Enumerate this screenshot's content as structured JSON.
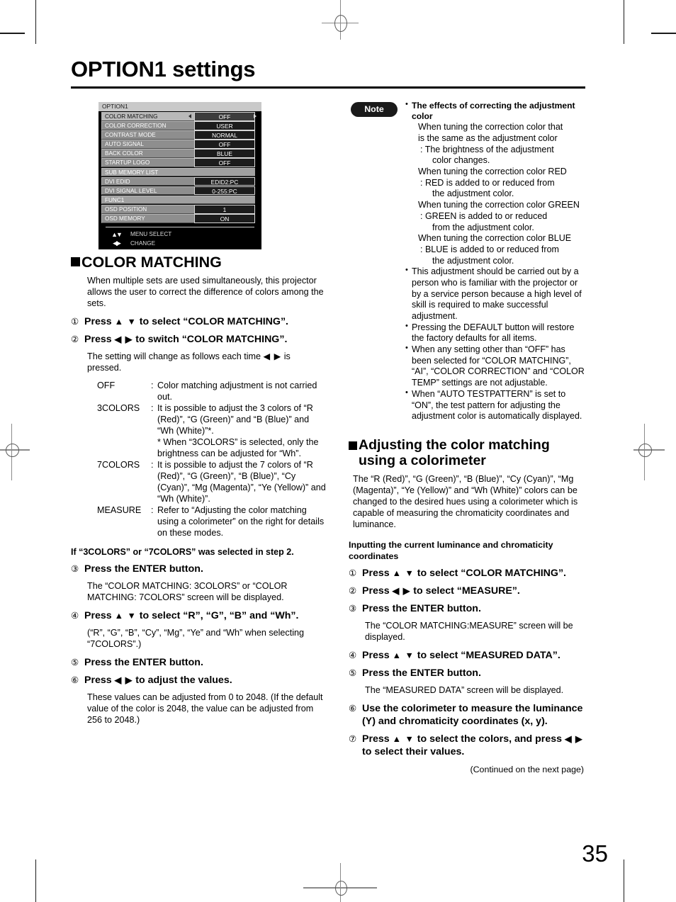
{
  "page": {
    "title": "OPTION1 settings",
    "number": "35"
  },
  "osd": {
    "title": "OPTION1",
    "rows": [
      {
        "label": "COLOR MATCHING",
        "value": "OFF",
        "selected": true,
        "full": false,
        "arrows": true
      },
      {
        "label": "COLOR CORRECTION",
        "value": "USER",
        "selected": false,
        "full": false,
        "arrows": false
      },
      {
        "label": "CONTRAST MODE",
        "value": "NORMAL",
        "selected": false,
        "full": false,
        "arrows": false
      },
      {
        "label": "AUTO SIGNAL",
        "value": "OFF",
        "selected": false,
        "full": false,
        "arrows": false
      },
      {
        "label": "BACK COLOR",
        "value": "BLUE",
        "selected": false,
        "full": false,
        "arrows": false
      },
      {
        "label": "STARTUP LOGO",
        "value": "OFF",
        "selected": false,
        "full": false,
        "arrows": false
      },
      {
        "label": "SUB MEMORY LIST",
        "value": "",
        "selected": false,
        "full": true,
        "arrows": false
      },
      {
        "label": "DVI EDID",
        "value": "EDID2:PC",
        "selected": false,
        "full": false,
        "arrows": false
      },
      {
        "label": "DVI SIGNAL LEVEL",
        "value": "0-255:PC",
        "selected": false,
        "full": false,
        "arrows": false
      },
      {
        "label": "FUNC1",
        "value": "",
        "selected": false,
        "full": true,
        "arrows": false
      },
      {
        "label": "OSD POSITION",
        "value": "1",
        "selected": false,
        "full": false,
        "arrows": false
      },
      {
        "label": "OSD MEMORY",
        "value": "ON",
        "selected": false,
        "full": false,
        "arrows": false
      }
    ],
    "footer": [
      {
        "icon": "▲▼",
        "label": "MENU SELECT"
      },
      {
        "icon": "◀▶",
        "label": "CHANGE"
      }
    ]
  },
  "left": {
    "heading": "COLOR MATCHING",
    "intro": "When multiple sets are used simultaneously, this projector allows the user to correct the difference of colors among the sets.",
    "steps": [
      {
        "num": "①",
        "pre": "Press",
        "arrows": "▲ ▼",
        "post": "to select “COLOR MATCHING”."
      },
      {
        "num": "②",
        "pre": "Press",
        "arrows": "◀ ▶",
        "post": "to switch “COLOR MATCHING”."
      }
    ],
    "change_note_pre": "The setting will change as follows each time",
    "change_note_arrows": "◀ ▶",
    "change_note_post": "is pressed.",
    "definitions": [
      {
        "term": "OFF",
        "desc": "Color matching adjustment is not carried out.",
        "sub": []
      },
      {
        "term": "3COLORS",
        "desc": "It is possible to adjust the 3 colors of “R (Red)”, “G (Green)” and “B (Blue)” and “Wh (White)”*.",
        "sub": [
          "* When “3COLORS” is selected, only the brightness can be adjusted for “Wh”."
        ]
      },
      {
        "term": "7COLORS",
        "desc": "It is possible to adjust the 7 colors of “R (Red)”, “G (Green)”, “B (Blue)”, “Cy (Cyan)”, “Mg (Magenta)”, “Ye (Yellow)” and “Wh (White)”.",
        "sub": []
      },
      {
        "term": "MEASURE",
        "desc": "Refer to “Adjusting the color matching using a colorimeter” on the right for details on these modes.",
        "sub": []
      }
    ],
    "condition": "If “3COLORS” or “7COLORS” was selected in step 2.",
    "steps2": [
      {
        "num": "③",
        "pre": "Press the ENTER button.",
        "arrows": "",
        "post": "",
        "body": "The “COLOR MATCHING: 3COLORS” or “COLOR MATCHING: 7COLORS” screen will be displayed."
      },
      {
        "num": "④",
        "pre": "Press",
        "arrows": "▲ ▼",
        "post": "to select “R”, “G”, “B” and “Wh”.",
        "body": "(“R”, “G”, “B”, “Cy”, “Mg”, “Ye” and “Wh” when selecting “7COLORS”.)"
      },
      {
        "num": "⑤",
        "pre": "Press the ENTER button.",
        "arrows": "",
        "post": "",
        "body": ""
      },
      {
        "num": "⑥",
        "pre": "Press",
        "arrows": "◀ ▶",
        "post": "to adjust the values.",
        "body": "These values can be adjusted from 0 to 2048. (If the default value of the color is 2048, the value can be adjusted from 256 to 2048.)"
      }
    ]
  },
  "right": {
    "note_label": "Note",
    "notes": [
      {
        "lead": "The effects of correcting the adjustment color",
        "lines": [
          {
            "indent": 1,
            "text": "When tuning the correction color that"
          },
          {
            "indent": 1,
            "text": "is the same as the adjustment color"
          },
          {
            "indent": 2,
            "text": ": The brightness of the adjustment"
          },
          {
            "indent": 3,
            "text": "color changes."
          },
          {
            "indent": 1,
            "text": "When tuning the correction color RED"
          },
          {
            "indent": 2,
            "text": ": RED is added to or reduced from"
          },
          {
            "indent": 3,
            "text": "the adjustment color."
          },
          {
            "indent": 1,
            "text": "When tuning the correction color GREEN"
          },
          {
            "indent": 2,
            "text": ": GREEN is added to or reduced"
          },
          {
            "indent": 3,
            "text": "from the adjustment color."
          },
          {
            "indent": 1,
            "text": "When tuning the correction color BLUE"
          },
          {
            "indent": 2,
            "text": ": BLUE is added to or reduced from"
          },
          {
            "indent": 3,
            "text": "the adjustment color."
          }
        ]
      },
      {
        "lead": "",
        "text": "This adjustment should be carried out by a person who is familiar with the projector or by a service person because a high level of skill is required to make successful adjustment."
      },
      {
        "lead": "",
        "text": "Pressing the DEFAULT button will restore the factory defaults for all items."
      },
      {
        "lead": "",
        "text": "When any setting other than “OFF” has been selected for “COLOR MATCHING”, “AI”, “COLOR CORRECTION” and “COLOR TEMP” settings are not adjustable."
      },
      {
        "lead": "",
        "text": "When “AUTO TESTPATTERN” is set to “ON”, the test pattern for adjusting the adjustment color is automatically displayed."
      }
    ],
    "heading_line1": "Adjusting the color matching",
    "heading_line2": "using a colorimeter",
    "intro": "The “R (Red)”, “G (Green)”, “B (Blue)”, “Cy (Cyan)”, “Mg (Magenta)”, “Ye (Yellow)” and “Wh (White)” colors can be changed to the desired hues using a colorimeter which is capable of measuring the chromaticity coordinates and luminance.",
    "sub_head": "Inputting the current luminance and chromaticity coordinates",
    "steps": [
      {
        "num": "①",
        "pre": "Press",
        "arrows": "▲ ▼",
        "post": "to select “COLOR MATCHING”.",
        "body": ""
      },
      {
        "num": "②",
        "pre": "Press",
        "arrows": "◀ ▶",
        "post": "to select “MEASURE”.",
        "body": ""
      },
      {
        "num": "③",
        "pre": "Press the ENTER button.",
        "arrows": "",
        "post": "",
        "body": "The “COLOR MATCHING:MEASURE” screen will be displayed."
      },
      {
        "num": "④",
        "pre": "Press",
        "arrows": "▲ ▼",
        "post": "to select “MEASURED DATA”.",
        "body": ""
      },
      {
        "num": "⑤",
        "pre": "Press the ENTER button.",
        "arrows": "",
        "post": "",
        "body": "The “MEASURED DATA” screen will be displayed."
      },
      {
        "num": "⑥",
        "pre": "Use the colorimeter to measure the luminance (Y) and chromaticity coordinates (x, y).",
        "arrows": "",
        "post": "",
        "body": ""
      },
      {
        "num": "⑦",
        "pre": "Press",
        "arrows": "▲ ▼",
        "post": "to select the colors, and press",
        "arrows2": "◀ ▶",
        "post2": "to select their values.",
        "body": ""
      }
    ],
    "continued": "(Continued on the next page)"
  }
}
